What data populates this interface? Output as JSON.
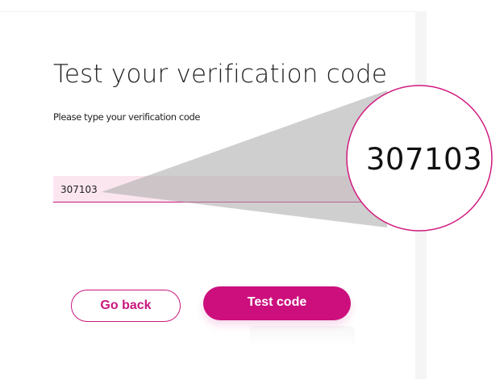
{
  "title": "Test your verification code",
  "instruction": "Please type your verification code",
  "code_input": {
    "value": "307103"
  },
  "magnifier": {
    "code": "307103"
  },
  "buttons": {
    "back": "Go back",
    "test": "Test code"
  },
  "colors": {
    "accent": "#cc0f7d",
    "field_bg": "#fbe6f0",
    "cone": "#c4c4c4"
  }
}
